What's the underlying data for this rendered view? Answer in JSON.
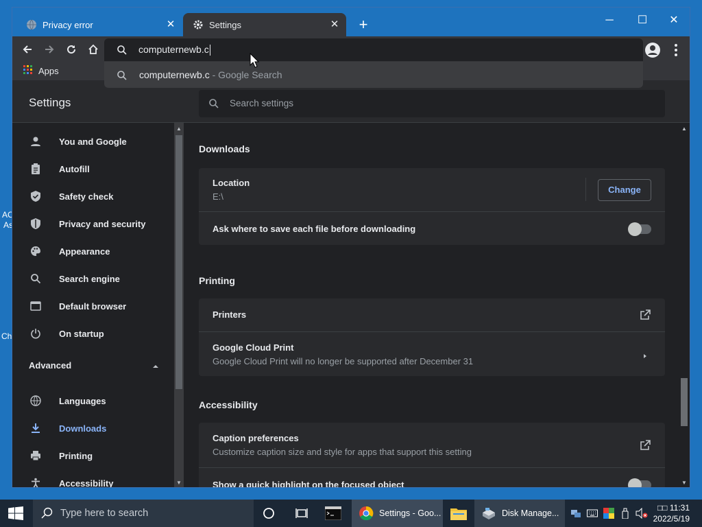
{
  "browser": {
    "tabs": [
      {
        "label": "Privacy error",
        "icon": "globe-icon"
      },
      {
        "label": "Settings",
        "icon": "gear-icon"
      }
    ],
    "omnibox": {
      "value": "computernewb.c"
    },
    "suggestion": {
      "query": "computernewb.c",
      "source": " - Google Search"
    },
    "bookmarks": {
      "apps": "Apps"
    }
  },
  "desktop": {
    "text1": "AC",
    "text2": "As",
    "text3": "Ch"
  },
  "settings": {
    "title": "Settings",
    "search_placeholder": "Search settings",
    "nav": [
      {
        "label": "You and Google",
        "icon": "person-icon"
      },
      {
        "label": "Autofill",
        "icon": "clipboard-icon"
      },
      {
        "label": "Safety check",
        "icon": "shield-check-icon"
      },
      {
        "label": "Privacy and security",
        "icon": "shield-icon"
      },
      {
        "label": "Appearance",
        "icon": "palette-icon"
      },
      {
        "label": "Search engine",
        "icon": "search-icon"
      },
      {
        "label": "Default browser",
        "icon": "browser-icon"
      },
      {
        "label": "On startup",
        "icon": "power-icon"
      }
    ],
    "advanced_label": "Advanced",
    "advanced_nav": [
      {
        "label": "Languages",
        "icon": "globe-icon"
      },
      {
        "label": "Downloads",
        "icon": "download-icon"
      },
      {
        "label": "Printing",
        "icon": "printer-icon"
      },
      {
        "label": "Accessibility",
        "icon": "accessibility-icon"
      }
    ],
    "downloads": {
      "title": "Downloads",
      "location_label": "Location",
      "location_value": "E:\\",
      "change_label": "Change",
      "ask_label": "Ask where to save each file before downloading",
      "ask_enabled": false
    },
    "printing": {
      "title": "Printing",
      "printers_label": "Printers",
      "cloud_label": "Google Cloud Print",
      "cloud_sub": "Google Cloud Print will no longer be supported after December 31"
    },
    "accessibility": {
      "title": "Accessibility",
      "caption_label": "Caption preferences",
      "caption_sub": "Customize caption size and style for apps that support this setting",
      "highlight_label": "Show a quick highlight on the focused object",
      "highlight_enabled": false
    }
  },
  "taskbar": {
    "search_placeholder": "Type here to search",
    "apps": [
      {
        "label": "Settings - Goo...",
        "icon": "chrome-icon"
      },
      {
        "label": "Disk Manage...",
        "icon": "disk-management-icon"
      }
    ],
    "clock_time": "□□ 11:31",
    "clock_date": "2022/5/19"
  },
  "colors": {
    "accent": "#8ab4f8",
    "window_frame": "#1e73be",
    "page_bg": "#202124",
    "card_bg": "#292a2d"
  }
}
